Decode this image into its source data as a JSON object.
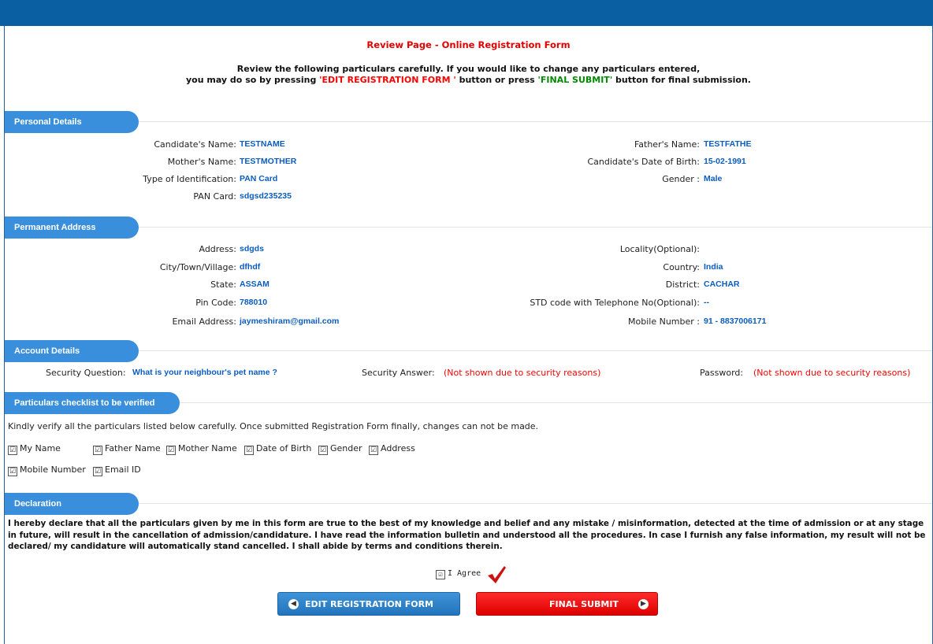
{
  "header": {
    "title": "Review Page - Online Registration Form"
  },
  "intro": {
    "line1": "Review the following particulars carefully. If you would like to change any particulars entered,",
    "line2_a": "you may do so by pressing ",
    "edit_ref": "'EDIT REGISTRATION FORM '",
    "line2_b": " button or press ",
    "final_ref": "'FINAL SUBMIT'",
    "line2_c": " button for final submission."
  },
  "personal": {
    "section_title": "Personal Details",
    "candidate_name_label": "Candidate's Name:",
    "candidate_name": "TESTNAME",
    "father_name_label": "Father's Name:",
    "father_name": "TESTFATHE",
    "mother_name_label": "Mother's Name:",
    "mother_name": "TESTMOTHER",
    "dob_label": "Candidate's Date of Birth:",
    "dob": "15-02-1991",
    "id_type_label": "Type of Identification:",
    "id_type": "PAN Card",
    "gender_label": "Gender :",
    "gender": "Male",
    "pan_label": "PAN Card:",
    "pan": "sdgsd235235"
  },
  "address": {
    "section_title": "Permanent Address",
    "address_label": "Address:",
    "address": "sdgds",
    "locality_label": "Locality(Optional):",
    "locality": "",
    "city_label": "City/Town/Village:",
    "city": "dfhdf",
    "country_label": "Country:",
    "country": "India",
    "state_label": "State:",
    "state": "ASSAM",
    "district_label": "District:",
    "district": "CACHAR",
    "pin_label": "Pin Code:",
    "pin": "788010",
    "std_label": "STD code with Telephone No(Optional):",
    "std": "--",
    "email_label": "Email Address:",
    "email": "jaymeshiram@gmail.com",
    "mobile_label": "Mobile Number :",
    "mobile": "91 - 8837006171"
  },
  "account": {
    "section_title": "Account Details",
    "question_label": "Security Question:",
    "question": "What is your neighbour's pet name ?",
    "answer_label": "Security Answer:",
    "answer": "(Not shown due to security reasons)",
    "password_label": "Password:",
    "password": "(Not shown due to security reasons)"
  },
  "checklist": {
    "section_title": "Particulars checklist to be verified",
    "instruction": "Kindly verify all the particulars listed below carefully. Once submitted Registration Form finally, changes can not be made.",
    "items": [
      "My Name",
      "Father Name",
      "Mother Name",
      "Date of Birth",
      "Gender",
      "Address",
      "Mobile Number",
      "Email ID"
    ],
    "check_glyph": "☑"
  },
  "declaration": {
    "section_title": "Declaration",
    "text": "I hereby declare that all the particulars given by me in this form are true to the best of my knowledge and belief and any mistake / misinformation, detected at the time of admission or at any stage in future, will result in the cancellation of admission/candidature. I have read the information bulletin and understood all the procedures. In case I furnish any false information, my result will not be declared/ my candidature will automatically stand cancelled. I shall abide by terms and conditions therein.",
    "agree_label": "I Agree",
    "check_glyph": "☑"
  },
  "buttons": {
    "edit": "EDIT REGISTRATION FORM",
    "final": "FINAL SUBMIT"
  },
  "colors": {
    "topbar": "#0a5fa3",
    "section_tab": "#3a8fdc",
    "value": "#0b5cc0",
    "edit_button": "#2f85cc",
    "final_button": "#ee0000",
    "checkmark": "#cc1111"
  },
  "icons": {
    "edit_icon": "chevron-left-circle-icon",
    "final_icon": "chevron-right-circle-icon",
    "agree_mark": "red-checkmark-icon"
  }
}
